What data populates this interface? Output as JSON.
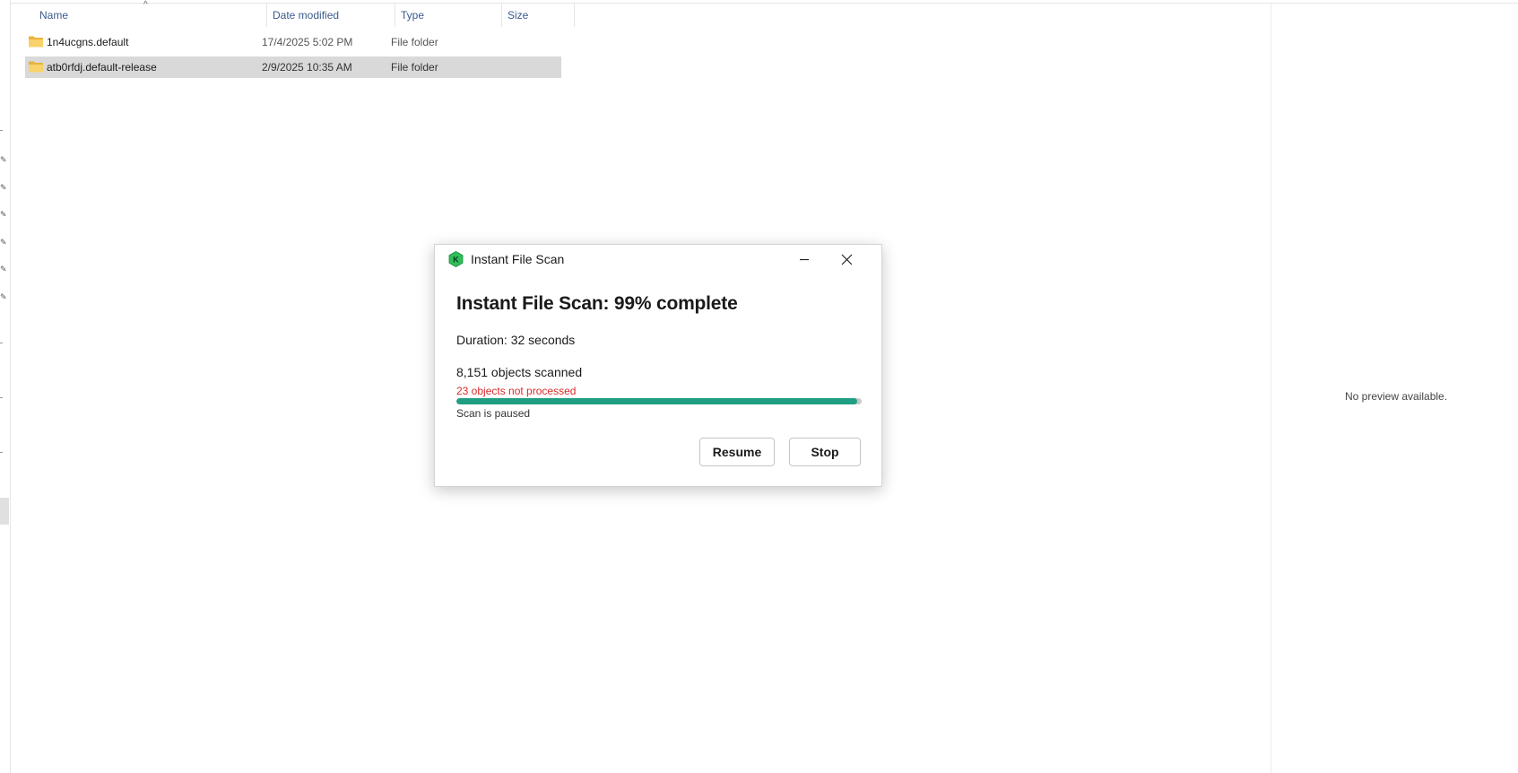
{
  "explorer": {
    "columns": {
      "name": "Name",
      "date_modified": "Date modified",
      "type": "Type",
      "size": "Size"
    },
    "files": [
      {
        "name": "1n4ucgns.default",
        "date": "17/4/2025 5:02 PM",
        "type": "File folder",
        "selected": false
      },
      {
        "name": "atb0rfdj.default-release",
        "date": "2/9/2025 10:35 AM",
        "type": "File folder",
        "selected": true
      }
    ],
    "preview_text": "No preview available."
  },
  "dialog": {
    "title": "Instant File Scan",
    "heading": "Instant File Scan: 99% complete",
    "duration": "Duration: 32 seconds",
    "objects_scanned": "8,151 objects scanned",
    "not_processed": "23 objects not processed",
    "status": "Scan is paused",
    "progress_percent": 99,
    "resume_label": "Resume",
    "stop_label": "Stop",
    "logo_icon": "kaspersky-logo-icon",
    "colors": {
      "progress": "#1f9e82",
      "warning": "#d92b2b",
      "logo": "#2fbf5a"
    }
  }
}
